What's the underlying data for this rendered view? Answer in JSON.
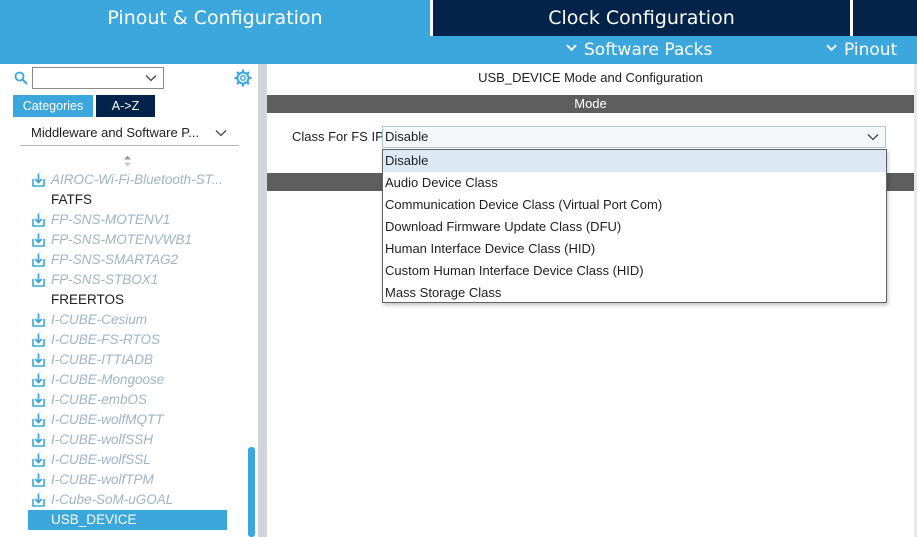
{
  "tabs": {
    "pinout_config": "Pinout & Configuration",
    "clock_config": "Clock Configuration"
  },
  "menu": {
    "software_packs": "Software Packs",
    "pinout": "Pinout"
  },
  "left": {
    "search": {
      "value": ""
    },
    "category_tabs": [
      "Categories",
      "A->Z"
    ],
    "category_select": "Middleware and Software P...",
    "packs": [
      {
        "label": "AIROC-Wi-Fi-Bluetooth-ST...",
        "external": true
      },
      {
        "label": "FATFS",
        "external": false
      },
      {
        "label": "FP-SNS-MOTENV1",
        "external": true
      },
      {
        "label": "FP-SNS-MOTENVWB1",
        "external": true
      },
      {
        "label": "FP-SNS-SMARTAG2",
        "external": true
      },
      {
        "label": "FP-SNS-STBOX1",
        "external": true
      },
      {
        "label": "FREERTOS",
        "external": false
      },
      {
        "label": "I-CUBE-Cesium",
        "external": true
      },
      {
        "label": "I-CUBE-FS-RTOS",
        "external": true
      },
      {
        "label": "I-CUBE-ITTIADB",
        "external": true
      },
      {
        "label": "I-CUBE-Mongoose",
        "external": true
      },
      {
        "label": "I-CUBE-embOS",
        "external": true
      },
      {
        "label": "I-CUBE-wolfMQTT",
        "external": true
      },
      {
        "label": "I-CUBE-wolfSSH",
        "external": true
      },
      {
        "label": "I-CUBE-wolfSSL",
        "external": true
      },
      {
        "label": "I-CUBE-wolfTPM",
        "external": true
      },
      {
        "label": "I-Cube-SoM-uGOAL",
        "external": true
      },
      {
        "label": "USB_DEVICE",
        "external": false,
        "selected": true
      }
    ]
  },
  "right": {
    "title": "USB_DEVICE Mode and Configuration",
    "mode_header": "Mode",
    "class_label": "Class For FS IP",
    "class_value": "Disable",
    "options": [
      "Disable",
      "Audio Device Class",
      "Communication Device Class (Virtual Port Com)",
      "Download Firmware Update Class (DFU)",
      "Human Interface Device Class (HID)",
      "Custom Human Interface Device Class (HID)",
      "Mass Storage Class"
    ],
    "highlighted_option": 0
  },
  "colors": {
    "accent": "#3ca7dc",
    "navy": "#03234b",
    "section_bar": "#5e5e5e",
    "external_pack_text": "#9fb4c5"
  }
}
